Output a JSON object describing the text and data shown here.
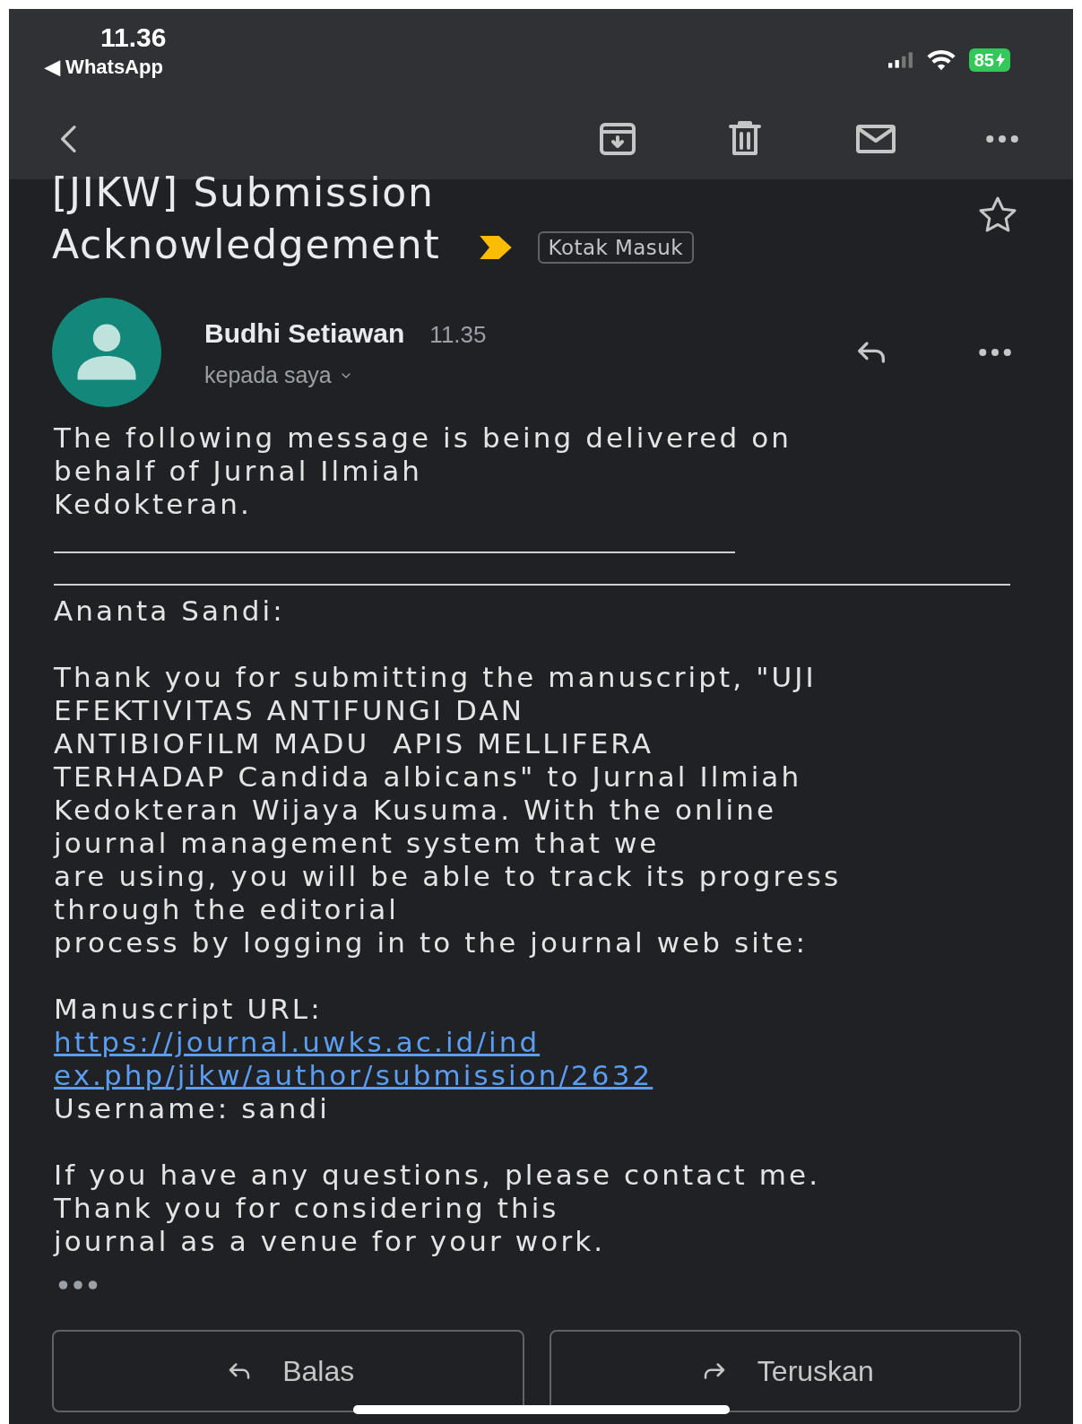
{
  "status_bar": {
    "time": "11.36",
    "back_app": "◀ WhatsApp",
    "battery": "85"
  },
  "subject": {
    "title": "[JIKW] Submission\nAcknowledgement",
    "label": "Kotak Masuk",
    "starred": false
  },
  "sender": {
    "name": "Budhi Setiawan",
    "time": "11.35",
    "recipient": "kepada saya"
  },
  "body": [
    {
      "kind": "text",
      "text": "The following message is being delivered on\nbehalf of Jurnal Ilmiah\nKedokteran."
    },
    {
      "kind": "rules"
    },
    {
      "kind": "text",
      "text": "Ananta Sandi:"
    },
    {
      "kind": "gap"
    },
    {
      "kind": "text",
      "text": "Thank you for submitting the manuscript, \"UJI\nEFEKTIVITAS ANTIFUNGI DAN\nANTIBIOFILM MADU  APIS MELLIFERA\nTERHADAP Candida albicans\" to Jurnal Ilmiah\nKedokteran Wijaya Kusuma. With the online\njournal management system that we\nare using, you will be able to track its progress\nthrough the editorial\nprocess by logging in to the journal web site:"
    },
    {
      "kind": "gap"
    },
    {
      "kind": "text",
      "text": "Manuscript URL:"
    },
    {
      "kind": "link",
      "text": "https://journal.uwks.ac.id/ind\nex.php/jikw/author/submission/2632"
    },
    {
      "kind": "text",
      "text": "Username: sandi"
    },
    {
      "kind": "gap"
    },
    {
      "kind": "text",
      "text": "If you have any questions, please contact me.\nThank you for considering this\njournal as a venue for your work."
    }
  ],
  "actions": [
    {
      "kind": "reply",
      "label": "Balas"
    },
    {
      "kind": "forward",
      "label": "Teruskan"
    }
  ]
}
